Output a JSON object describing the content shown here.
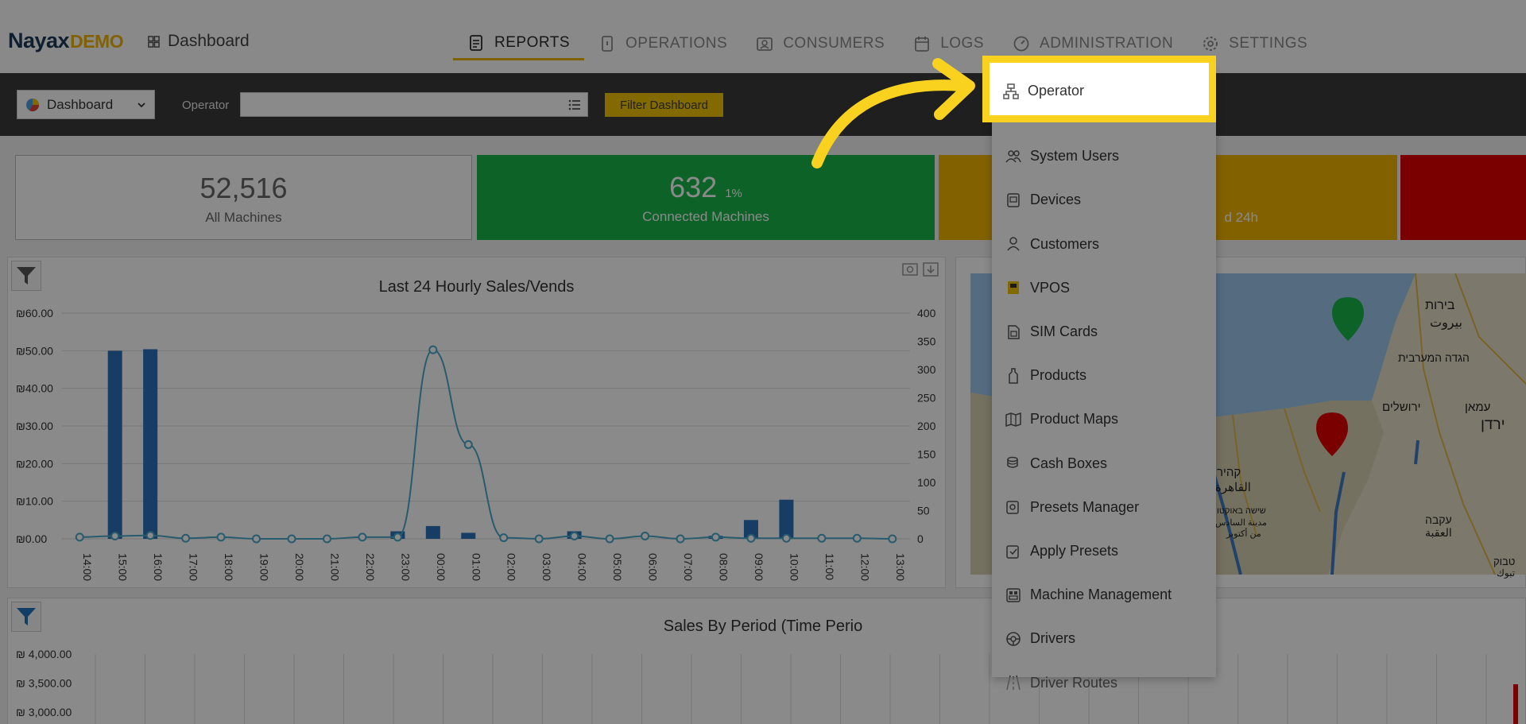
{
  "header": {
    "logo_main": "Nayax",
    "logo_suffix": "DEMO",
    "breadcrumb": "Dashboard",
    "tabs": [
      {
        "label": "REPORTS",
        "icon": "report-icon"
      },
      {
        "label": "OPERATIONS",
        "icon": "tablet-icon"
      },
      {
        "label": "CONSUMERS",
        "icon": "consumer-card-icon"
      },
      {
        "label": "LOGS",
        "icon": "calendar-icon"
      },
      {
        "label": "ADMINISTRATION",
        "icon": "gauge-icon"
      },
      {
        "label": "SETTINGS",
        "icon": "gear-icon"
      }
    ]
  },
  "filterbar": {
    "dashboard_select": "Dashboard",
    "operator_label": "Operator",
    "operator_value": "",
    "filter_button": "Filter Dashboard"
  },
  "stats": {
    "all_machines": {
      "value": "52,516",
      "label": "All Machines"
    },
    "connected": {
      "value": "632",
      "percent": "1%",
      "label": "Connected Machines"
    },
    "warning_label_fragment": "d 24h"
  },
  "chart_data": [
    {
      "type": "bar",
      "title": "Last 24 Hourly Sales/Vends",
      "categories": [
        "14:00",
        "15:00",
        "16:00",
        "17:00",
        "18:00",
        "19:00",
        "20:00",
        "21:00",
        "22:00",
        "23:00",
        "00:00",
        "01:00",
        "02:00",
        "03:00",
        "04:00",
        "05:00",
        "06:00",
        "07:00",
        "08:00",
        "09:00",
        "10:00",
        "11:00",
        "12:00",
        "13:00"
      ],
      "series": [
        {
          "axis": "left",
          "kind": "bar",
          "values": [
            0,
            50,
            50.4,
            0,
            0,
            0,
            0,
            0,
            0,
            2,
            3.4,
            1.6,
            0,
            0,
            2,
            0,
            0,
            0,
            0.8,
            5,
            10.4,
            0,
            0,
            0
          ]
        },
        {
          "axis": "right",
          "kind": "line",
          "values": [
            3,
            5,
            6,
            1,
            3,
            0,
            0,
            0,
            3,
            3,
            335,
            167,
            2,
            0,
            5,
            0,
            5,
            0,
            3,
            1,
            1,
            1,
            1,
            0
          ]
        }
      ],
      "ylim_left": [
        0,
        60
      ],
      "yticks_left": [
        "₪0.00",
        "₪10.00",
        "₪20.00",
        "₪30.00",
        "₪40.00",
        "₪50.00",
        "₪60.00"
      ],
      "ylim_right": [
        0,
        400
      ],
      "yticks_right": [
        "0",
        "50",
        "100",
        "150",
        "200",
        "250",
        "300",
        "350",
        "400"
      ],
      "colors": {
        "bar": "#2b72b9",
        "line": "#4aa8c9"
      }
    },
    {
      "type": "bar",
      "title": "Sales By Period (Time Perio",
      "yticks_left": [
        "₪ 4,000.00",
        "₪ 3,500.00",
        "₪ 3,000.00"
      ]
    }
  ],
  "map": {
    "labels": [
      "בירות",
      "بيروت",
      "הגדה המערבית",
      "ירושלים",
      "עמאן",
      "ירדן",
      "קהיר",
      "القاهرة",
      "שישה באוקטו",
      "مدينة السادس",
      "من أكتوبر",
      "עקבה",
      "العقبة",
      "טבוק",
      "تبوك"
    ]
  },
  "menu": {
    "highlighted": "Operator",
    "items": [
      {
        "label": "Operator",
        "icon": "sitemap-icon"
      },
      {
        "label": "System Users",
        "icon": "users-icon"
      },
      {
        "label": "Devices",
        "icon": "device-icon"
      },
      {
        "label": "Customers",
        "icon": "customer-icon"
      },
      {
        "label": "VPOS",
        "icon": "vpos-icon"
      },
      {
        "label": "SIM Cards",
        "icon": "sim-card-icon"
      },
      {
        "label": "Products",
        "icon": "bottle-icon"
      },
      {
        "label": "Product Maps",
        "icon": "map-icon"
      },
      {
        "label": "Cash Boxes",
        "icon": "coins-icon"
      },
      {
        "label": "Presets Manager",
        "icon": "preset-icon"
      },
      {
        "label": "Apply Presets",
        "icon": "apply-preset-icon"
      },
      {
        "label": "Machine Management",
        "icon": "machine-icon"
      },
      {
        "label": "Drivers",
        "icon": "steering-wheel-icon"
      },
      {
        "label": "Driver Routes",
        "icon": "road-icon"
      }
    ]
  },
  "colors": {
    "accent": "#f1c400",
    "connected_green": "#17b548",
    "warning_orange": "#f0b400",
    "alert_red": "#e10000",
    "highlight_yellow": "#f8d21f"
  }
}
